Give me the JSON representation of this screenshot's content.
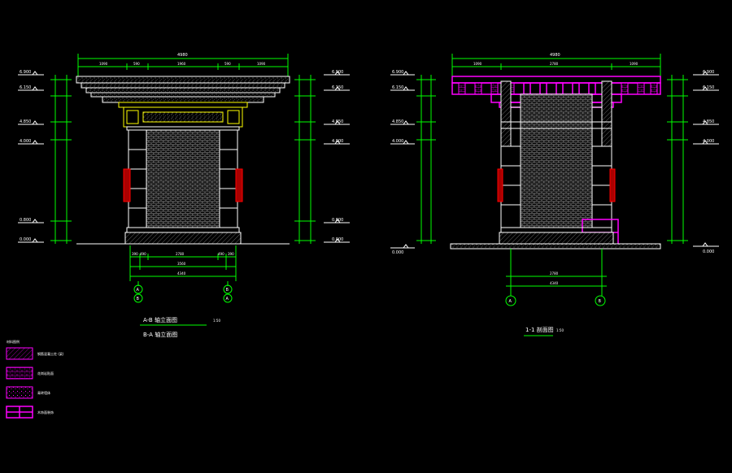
{
  "drawing_left": {
    "title": "A-B 轴立面图",
    "title_alt": "B-A 轴立面图",
    "scale": "1:50",
    "overall_width": "4980",
    "top_segments": [
      "1090",
      "590",
      "1960",
      "590",
      "1090"
    ],
    "levels_left": [
      "6.900",
      "6.150",
      "4.850",
      "4.000",
      "0.800",
      "0.000"
    ],
    "levels_right": [
      "6.900",
      "6.150",
      "4.850",
      "4.000",
      "0.800",
      "0.000"
    ],
    "bottom_segments": [
      "390",
      "490",
      "2780",
      "490",
      "390"
    ],
    "bottom_total": "3560",
    "bottom_overall": "4340",
    "axis_a_top": "A",
    "axis_a_bottom": "B",
    "axis_b_top": "B",
    "axis_b_bottom": "A"
  },
  "drawing_right": {
    "title": "1-1 剖面图",
    "scale": "1:50",
    "overall_width": "4980",
    "top_segments": [
      "1090",
      "2780",
      "1090"
    ],
    "levels_left": [
      "6.900",
      "6.150",
      "4.850",
      "4.000",
      "0.000"
    ],
    "levels_right": [
      "6.900",
      "6.150",
      "4.850",
      "4.000",
      "0.000"
    ],
    "bottom_segment": "2780",
    "bottom_total": "4340",
    "axis_left": "A",
    "axis_right": "B"
  },
  "legend": {
    "title": "材料图例",
    "items": [
      {
        "label": "钢筋混凝土柱 (梁)",
        "pattern": "hatch"
      },
      {
        "label": "花岗岩贴面",
        "pattern": "grid"
      },
      {
        "label": "青砖墙体",
        "pattern": "dots"
      },
      {
        "label": "木饰面装饰",
        "pattern": "panel"
      }
    ]
  },
  "colors": {
    "background": "#000000",
    "dimension": "#00ff00",
    "outline": "#ffffff",
    "accent": "#ffff00",
    "section": "#ff00ff",
    "red": "#ff0000",
    "cyan": "#00ffff"
  }
}
